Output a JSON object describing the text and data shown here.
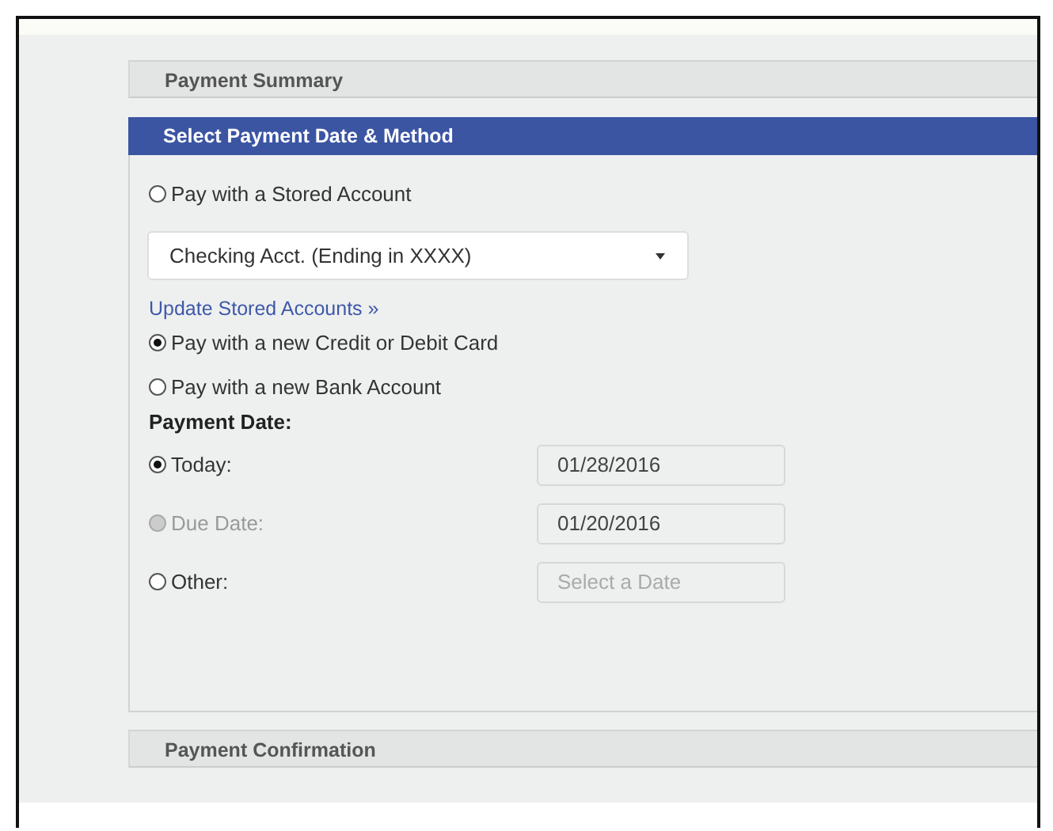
{
  "payment_summary": {
    "title": "Payment Summary"
  },
  "method_panel": {
    "title": "Select Payment Date & Method",
    "items": [
      {
        "kind": "radio",
        "label": "Pay with a Stored Account",
        "selected": false
      },
      {
        "kind": "select",
        "value": "Checking Acct. (Ending in XXXX)"
      },
      {
        "kind": "link",
        "label": "Update Stored Accounts »"
      },
      {
        "kind": "radio",
        "label": "Pay with a new Credit or Debit Card",
        "selected": true
      },
      {
        "kind": "radio",
        "label": "Pay with a new Bank Account",
        "selected": false
      }
    ],
    "payment_date": {
      "label": "Payment Date:",
      "options": [
        {
          "label": "Today:",
          "selected": true,
          "disabled": false,
          "value": "01/28/2016"
        },
        {
          "label": "Due Date:",
          "selected": false,
          "disabled": true,
          "value": "01/20/2016"
        },
        {
          "label": "Other:",
          "selected": false,
          "disabled": false,
          "placeholder": "Select a Date"
        }
      ]
    }
  },
  "payment_confirmation": {
    "title": "Payment Confirmation"
  }
}
